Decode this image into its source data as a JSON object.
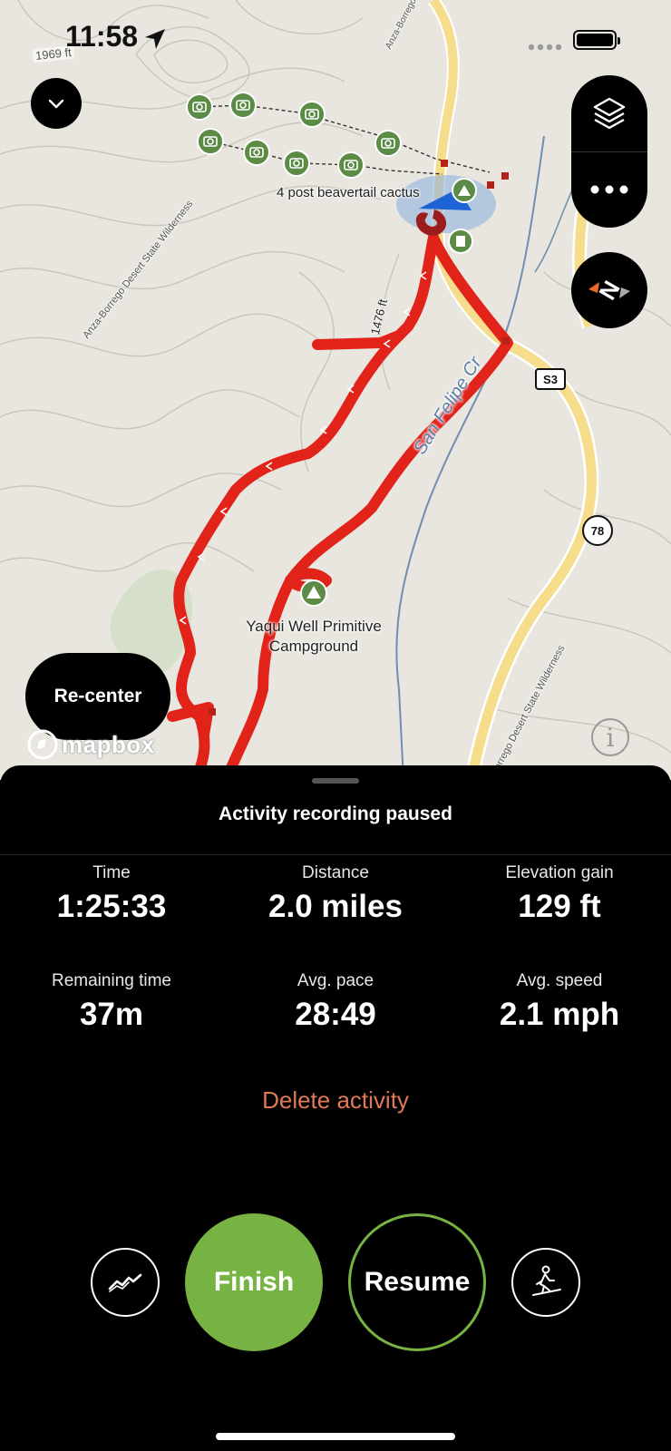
{
  "status_bar": {
    "time": "11:58",
    "elevation_tag": "1969 ft",
    "icons": [
      "location-arrow-icon",
      "signal-dots-icon",
      "battery-icon"
    ]
  },
  "map": {
    "labels": {
      "poi": "4 post beavertail cactus",
      "campground": "Yaqui Well Primitive Campground",
      "campground_line1": "Yaqui Well Primitive",
      "campground_line2": "Campground",
      "contour_1476": "1476 ft",
      "creek": "San Felipe Cr",
      "route_s3": "S3",
      "route_78": "78",
      "wilderness_left": "Anza-Borrego Desert State Wilderness",
      "wilderness_right": "orrego Desert State Wilderness",
      "wilderness_top": "Anza-Borrego Des"
    },
    "controls": {
      "collapse_icon": "chevron-down-icon",
      "layers_icon": "layers-icon",
      "more_icon": "more-dots-icon",
      "compass_icon": "compass-icon"
    },
    "recenter_label": "Re-center",
    "attribution": "mapbox",
    "colors": {
      "track": "#e2231a",
      "road": "#f5dd8c",
      "creek": "#6f8fb0",
      "poi_green": "#5c8b46",
      "accent": "#77b343"
    }
  },
  "sheet": {
    "title": "Activity recording paused",
    "stats": [
      {
        "label": "Time",
        "value": "1:25:33"
      },
      {
        "label": "Distance",
        "value": "2.0 miles"
      },
      {
        "label": "Elevation gain",
        "value": "129 ft"
      },
      {
        "label": "Remaining time",
        "value": "37m"
      },
      {
        "label": "Avg. pace",
        "value": "28:49"
      },
      {
        "label": "Avg. speed",
        "value": "2.1 mph"
      }
    ],
    "delete_label": "Delete activity",
    "finish_label": "Finish",
    "resume_label": "Resume",
    "left_icon": "chart-line-icon",
    "right_icon": "activity-hiking-icon"
  }
}
